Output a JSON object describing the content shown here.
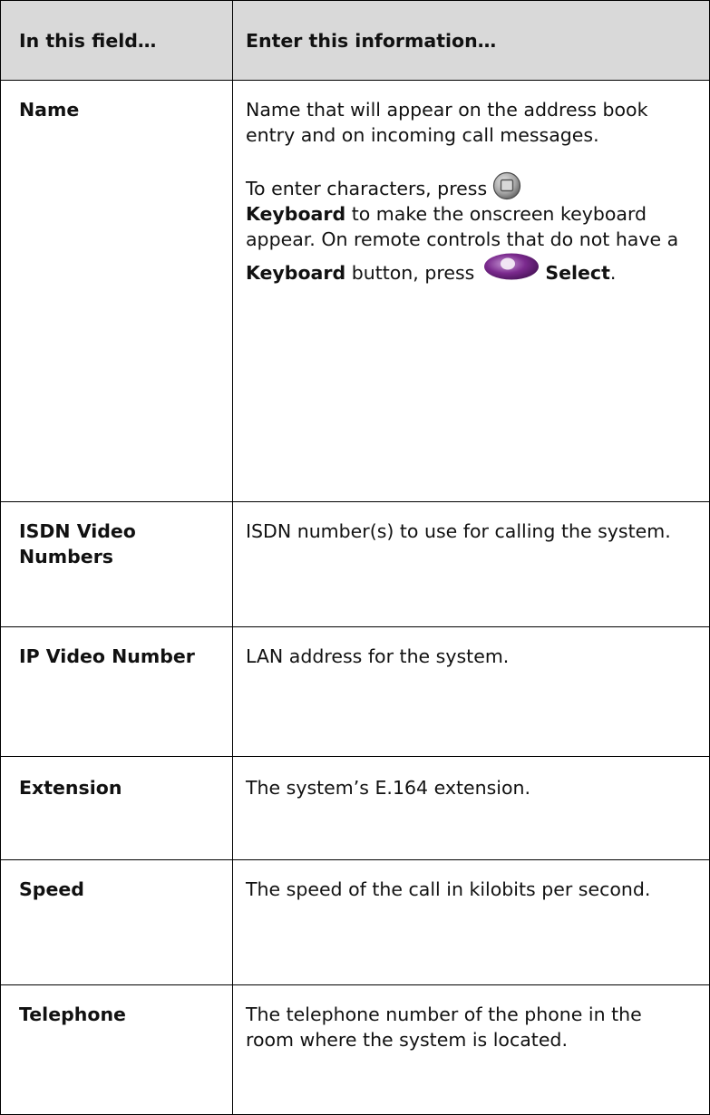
{
  "table": {
    "headers": {
      "field": "In this field…",
      "info": "Enter this information…"
    },
    "rows": {
      "name": {
        "field": "Name",
        "p1": "Name that will appear on the address book entry and on incoming call messages.",
        "p2_pre": "To enter characters, press",
        "p2_kw1": "Keyboard",
        "p2_mid": " to make the onscreen keyboard appear. On remote controls that do not have a ",
        "p2_kw2": "Keyboard",
        "p2_mid2": " button, press",
        "p2_kw3": "Select",
        "p2_end": "."
      },
      "isdn": {
        "field": "ISDN Video Numbers",
        "info": "ISDN number(s) to use for calling the system."
      },
      "ip": {
        "field": "IP Video Number",
        "info": "LAN address for the system."
      },
      "extension": {
        "field": "Extension",
        "info": "The system’s E.164 extension."
      },
      "speed": {
        "field": "Speed",
        "info": "The speed of the call in kilobits per second."
      },
      "telephone": {
        "field": "Telephone",
        "info": "The telephone number of the phone in the room where the system is located."
      }
    }
  },
  "icons": {
    "keyboard_button": "keyboard-button-icon",
    "select_button": "select-button-icon"
  },
  "colors": {
    "header_bg": "#d9d9d9",
    "border": "#000000",
    "select_button": "#7b2a8e",
    "keyboard_button": "#8a8a8a"
  }
}
